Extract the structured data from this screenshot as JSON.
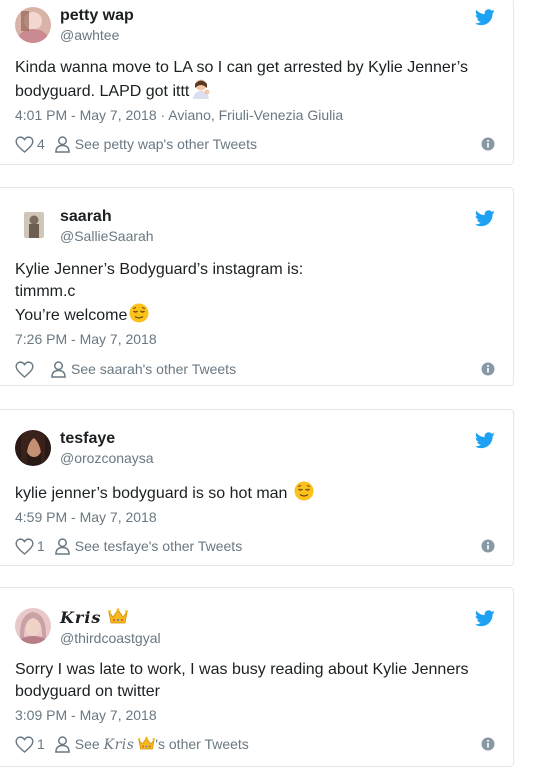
{
  "colors": {
    "twitter_blue": "#1da1f2",
    "text": "#1c2022",
    "muted": "#697882",
    "border": "#e1e8ed"
  },
  "tweets": [
    {
      "name": "petty wap",
      "handle": "@awhtee",
      "text_lines": [
        "Kinda wanna move to LA so I can get arrested by Kylie Jenner’s",
        "bodyguard. LAPD got ittt"
      ],
      "emoji": "woman-tipping-hand-emoji",
      "timestamp": "4:01 PM - May 7, 2018 · Aviano, Friuli-Venezia Giulia",
      "likes": "4",
      "see_tweets": "See petty wap's other Tweets"
    },
    {
      "name": "saarah",
      "handle": "@SallieSaarah",
      "text_lines": [
        "Kylie Jenner’s Bodyguard’s instagram is:",
        "timmm.c",
        "You’re welcome"
      ],
      "emoji": "relieved-face-emoji",
      "timestamp": "7:26 PM - May 7, 2018",
      "likes": "",
      "see_tweets": "See saarah's other Tweets"
    },
    {
      "name": "tesfaye",
      "handle": "@orozconaysa",
      "text_lines": [
        "kylie jenner’s bodyguard is so hot man"
      ],
      "emoji": "relieved-face-emoji",
      "timestamp": "4:59 PM - May 7, 2018",
      "likes": "1",
      "see_tweets": "See tesfaye's other Tweets"
    },
    {
      "name": "Kris",
      "handle": "@thirdcoastgyal",
      "text_lines": [
        "Sorry I was late to work, I was busy reading about Kylie Jenners",
        "bodyguard on twitter"
      ],
      "emoji": "crown-emoji",
      "timestamp": "3:09 PM - May 7, 2018",
      "likes": "1",
      "see_prefix": "See ",
      "see_name": "Kris",
      "see_suffix": "'s other Tweets"
    }
  ]
}
